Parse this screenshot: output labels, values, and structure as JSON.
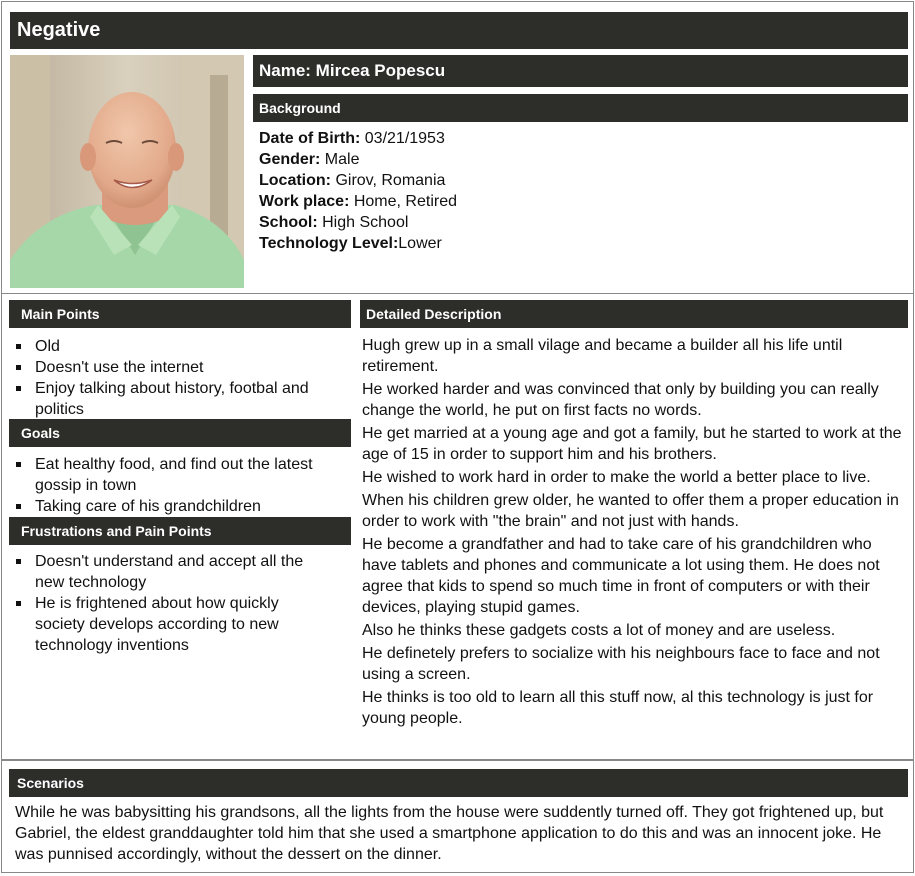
{
  "persona_type": "Negative",
  "name_line": "Name: Mircea Popescu",
  "background": {
    "title": "Background",
    "fields": [
      {
        "label": "Date of Birth:",
        "value": " 03/21/1953"
      },
      {
        "label": "Gender:",
        "value": " Male"
      },
      {
        "label": "Location:",
        "value": " Girov, Romania"
      },
      {
        "label": "Work place:",
        "value": " Home, Retired"
      },
      {
        "label": "School:",
        "value": " High School"
      },
      {
        "label": "Technology Level:",
        "value": "Lower"
      }
    ]
  },
  "main_points": {
    "title": "Main Points",
    "items": [
      "Old",
      "Doesn't use the internet",
      "Enjoy talking about history, footbal and politics"
    ]
  },
  "goals": {
    "title": "Goals",
    "items": [
      "Eat healthy food, and find out the latest gossip in town",
      "Taking care of his grandchildren"
    ]
  },
  "frustrations": {
    "title": "Frustrations and Pain Points",
    "items": [
      "Doesn't understand and accept all the new technology",
      "He is frightened about how quickly society develops according to new technology inventions"
    ]
  },
  "description": {
    "title": "Detailed Description",
    "paragraphs": [
      "Hugh grew up in a small vilage and became a builder all his life until retirement.",
      "He worked harder and was convinced that only by building you can really change the world, he put on first facts no words.",
      "He get married at a young age and got a family, but he started to work at the age of 15 in order to support him and his brothers.",
      "He wished to work hard in order to make the world a better place to live.",
      "When his children grew older, he wanted to offer them a proper education in order to work with \"the brain\" and not just with hands.",
      "He become a grandfather and had to take care of his grandchildren who have tablets and phones and communicate a lot using them. He does not agree that kids to spend so much time in front of computers or with their devices, playing stupid games.",
      "Also he thinks these gadgets costs a lot of money and are useless.",
      "He definetely prefers to socialize with his neighbours face to face and not using a screen.",
      "He thinks is too old to learn all this stuff now, al this technology is just for young people."
    ]
  },
  "scenarios": {
    "title": "Scenarios",
    "text": "While he was babysitting his grandsons, all the lights from the house were suddently turned off. They got frightened up, but Gabriel, the eldest granddaughter told him that she used a smartphone application to do this and was an innocent joke. He was punnised accordingly, without the dessert on the dinner."
  },
  "colors": {
    "header_bar": "#2d2d2a",
    "header_text": "#ffffff",
    "border": "#888888"
  }
}
